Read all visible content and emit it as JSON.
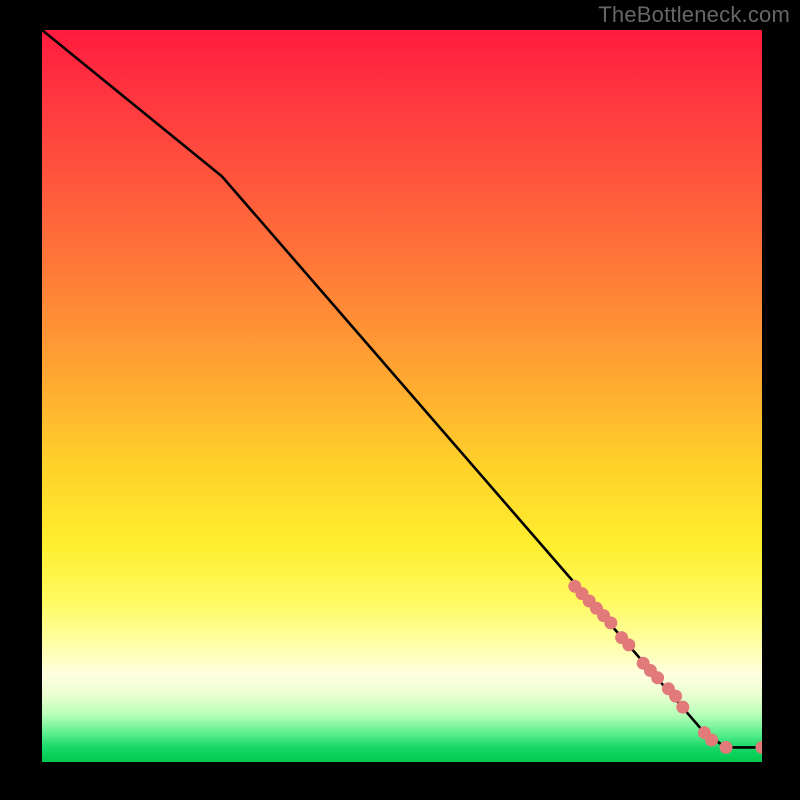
{
  "watermark": "TheBottleneck.com",
  "chart_data": {
    "type": "line",
    "title": "",
    "xlabel": "",
    "ylabel": "",
    "xlim": [
      0,
      100
    ],
    "ylim": [
      0,
      100
    ],
    "curve": {
      "name": "bottleneck-curve",
      "points": [
        {
          "x": 0,
          "y": 100
        },
        {
          "x": 25,
          "y": 80
        },
        {
          "x": 92,
          "y": 4
        },
        {
          "x": 95,
          "y": 2
        },
        {
          "x": 100,
          "y": 2
        }
      ]
    },
    "markers": {
      "name": "highlight-segments",
      "color": "#e27a7a",
      "points": [
        {
          "x": 74.0,
          "y": 24.0
        },
        {
          "x": 75.0,
          "y": 23.0
        },
        {
          "x": 76.0,
          "y": 22.0
        },
        {
          "x": 77.0,
          "y": 21.0
        },
        {
          "x": 78.0,
          "y": 20.0
        },
        {
          "x": 79.0,
          "y": 19.0
        },
        {
          "x": 80.5,
          "y": 17.0
        },
        {
          "x": 81.5,
          "y": 16.0
        },
        {
          "x": 83.5,
          "y": 13.5
        },
        {
          "x": 84.5,
          "y": 12.5
        },
        {
          "x": 85.5,
          "y": 11.5
        },
        {
          "x": 87.0,
          "y": 10.0
        },
        {
          "x": 88.0,
          "y": 9.0
        },
        {
          "x": 89.0,
          "y": 7.5
        },
        {
          "x": 92.0,
          "y": 4.0
        },
        {
          "x": 93.0,
          "y": 3.0
        },
        {
          "x": 95.0,
          "y": 2.0
        },
        {
          "x": 100.0,
          "y": 2.0
        }
      ]
    },
    "gradient_stops": [
      {
        "pos": 0,
        "color": "#ff1b3e"
      },
      {
        "pos": 50,
        "color": "#ffb030"
      },
      {
        "pos": 70,
        "color": "#ffee2e"
      },
      {
        "pos": 88,
        "color": "#ffffe0"
      },
      {
        "pos": 100,
        "color": "#00c94e"
      }
    ]
  }
}
